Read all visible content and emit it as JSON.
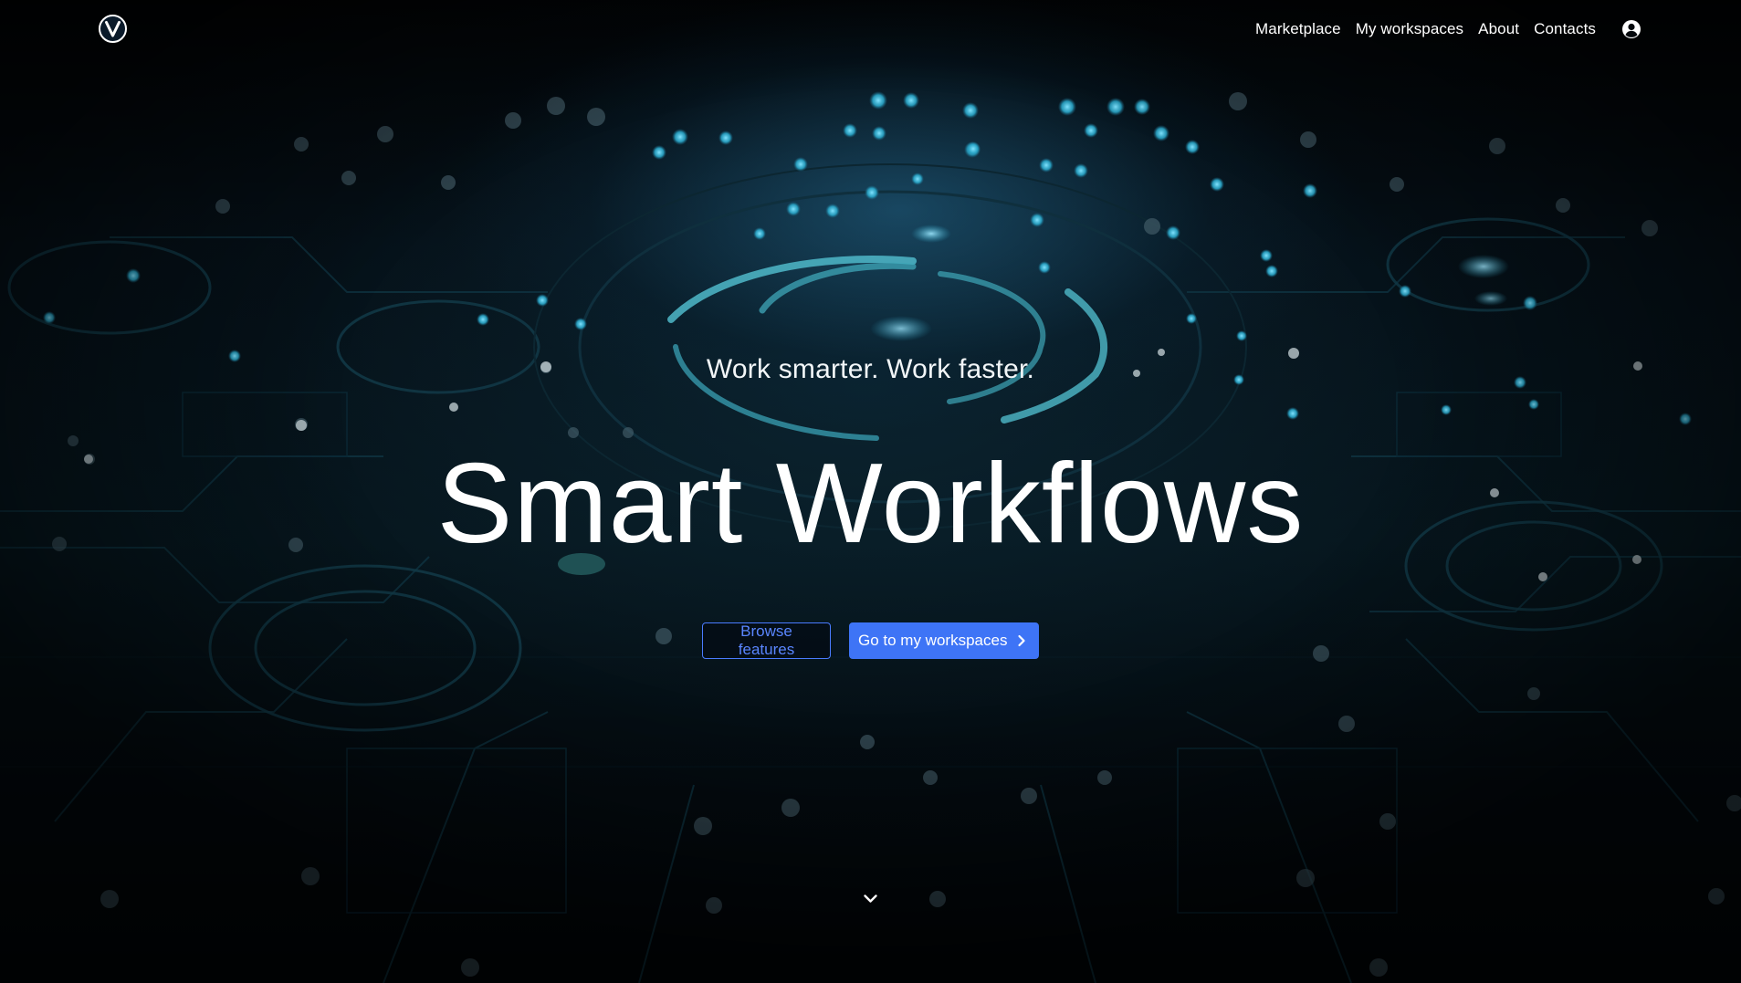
{
  "nav": {
    "logo_icon": "circle-v-logo-icon",
    "items": [
      {
        "label": "Marketplace"
      },
      {
        "label": "My workspaces"
      },
      {
        "label": "About"
      },
      {
        "label": "Contacts"
      }
    ],
    "user_icon": "user-circle-icon"
  },
  "hero": {
    "tagline": "Work smarter. Work faster.",
    "title": "Smart Workflows",
    "browse_label": "Browse features",
    "workspaces_label": "Go to my workspaces",
    "workspaces_icon": "chevron-right-icon",
    "scroll_icon": "chevron-down-icon"
  },
  "colors": {
    "accent": "#3e74f6",
    "outline": "#4a7bff",
    "background": "#020406",
    "glow": "#2aa6c8"
  }
}
